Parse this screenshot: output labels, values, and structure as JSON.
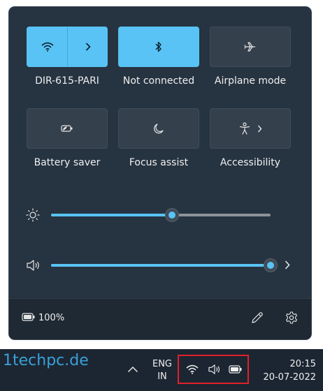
{
  "quick_settings": {
    "tiles": [
      {
        "label": "DIR-615-PARI",
        "icon": "wifi-icon",
        "active": true
      },
      {
        "label": "Not connected",
        "icon": "bluetooth-icon",
        "active": true
      },
      {
        "label": "Airplane mode",
        "icon": "airplane-icon",
        "active": false
      },
      {
        "label": "Battery saver",
        "icon": "battery-saver-icon",
        "active": false
      },
      {
        "label": "Focus assist",
        "icon": "moon-icon",
        "active": false
      },
      {
        "label": "Accessibility",
        "icon": "accessibility-icon",
        "active": false
      }
    ],
    "brightness": {
      "icon": "brightness-icon",
      "level": 0.55
    },
    "volume": {
      "icon": "speaker-icon",
      "level": 1.0
    },
    "battery_percent": "100%"
  },
  "taskbar": {
    "language_top": "ENG",
    "language_bottom": "IN",
    "time": "20:15",
    "date": "20-07-2022"
  },
  "watermark": "1techpc.de",
  "colors": {
    "accent": "#58c3f4",
    "panel": "#263340",
    "tile": "#34404c",
    "highlight_box": "#e0202a"
  }
}
